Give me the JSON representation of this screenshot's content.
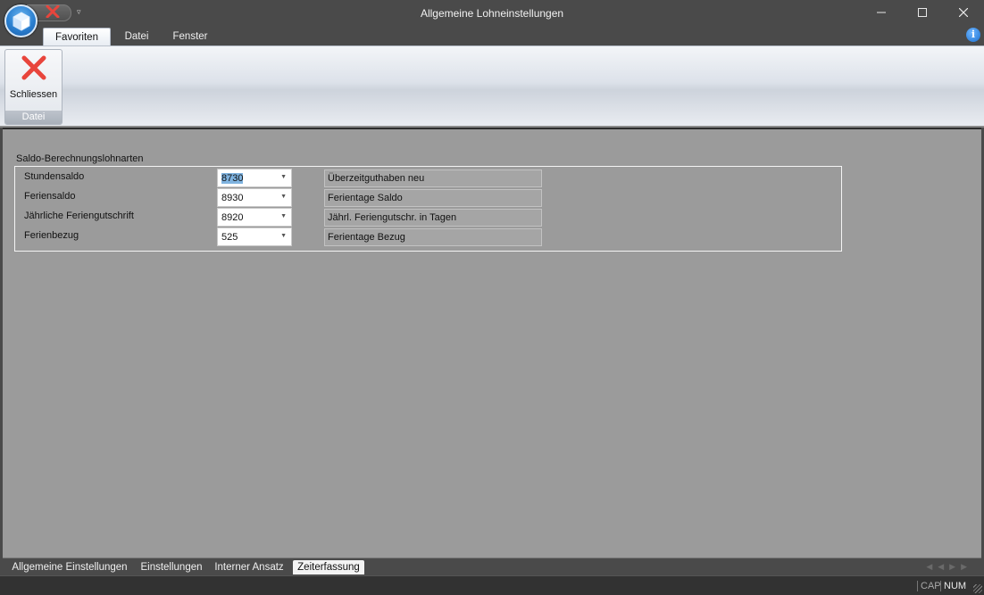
{
  "window": {
    "title": "Allgemeine Lohneinstellungen"
  },
  "ribbon": {
    "tabs": [
      {
        "label": "Favoriten",
        "active": true
      },
      {
        "label": "Datei",
        "active": false
      },
      {
        "label": "Fenster",
        "active": false
      }
    ],
    "group": {
      "button_label": "Schliessen",
      "group_label": "Datei"
    }
  },
  "form": {
    "section_title": "Saldo-Berechnungslohnarten",
    "rows": [
      {
        "label": "Stundensaldo",
        "value": "8730",
        "description": "Überzeitguthaben neu"
      },
      {
        "label": "Feriensaldo",
        "value": "8930",
        "description": "Ferientage Saldo"
      },
      {
        "label": "Jährliche Feriengutschrift",
        "value": "8920",
        "description": "Jährl. Feriengutschr. in Tagen"
      },
      {
        "label": "Ferienbezug",
        "value": "525",
        "description": "Ferientage Bezug"
      }
    ]
  },
  "doc_tabs": [
    {
      "label": "Allgemeine Einstellungen",
      "active": false
    },
    {
      "label": "Einstellungen",
      "active": false
    },
    {
      "label": "Interner Ansatz",
      "active": false
    },
    {
      "label": "Zeiterfassung",
      "active": true
    }
  ],
  "status": {
    "cap": "CAP",
    "num": "NUM"
  },
  "colors": {
    "close_red": "#e8453c",
    "content_bg": "#9b9b9b",
    "accent_blue": "#2a7fd0"
  }
}
